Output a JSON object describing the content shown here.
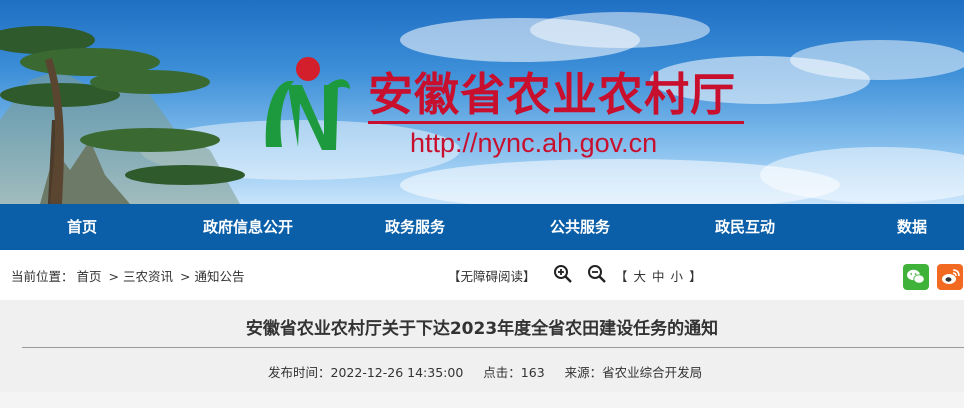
{
  "site": {
    "name": "安徽省农业农村厅",
    "url": "http://nync.ah.gov.cn"
  },
  "nav": {
    "items": [
      {
        "label": "首页"
      },
      {
        "label": "政府信息公开"
      },
      {
        "label": "政务服务"
      },
      {
        "label": "公共服务"
      },
      {
        "label": "政民互动"
      },
      {
        "label": "数据"
      }
    ]
  },
  "toolbar": {
    "breadcrumb_label": "当前位置：",
    "breadcrumb": [
      "首页",
      "三农资讯",
      "通知公告"
    ],
    "breadcrumb_sep": ">",
    "accessibility": "【无障碍阅读】",
    "font_size": {
      "open": "【",
      "large": "大",
      "medium": "中",
      "small": "小",
      "close": "】"
    }
  },
  "article": {
    "title": "安徽省农业农村厅关于下达2023年度全省农田建设任务的通知",
    "publish_label": "发布时间：",
    "publish_time": "2022-12-26 14:35:00",
    "clicks_label": "点击：",
    "clicks": "163",
    "source_label": "来源：",
    "source": "省农业综合开发局"
  },
  "colors": {
    "brand_red": "#c8102e",
    "nav_blue": "#0b5fa8",
    "wechat_green": "#3fb23a",
    "weibo_orange": "#f26a21"
  },
  "icons": [
    "zoom-in-icon",
    "zoom-out-icon",
    "wechat-icon",
    "weibo-icon"
  ]
}
